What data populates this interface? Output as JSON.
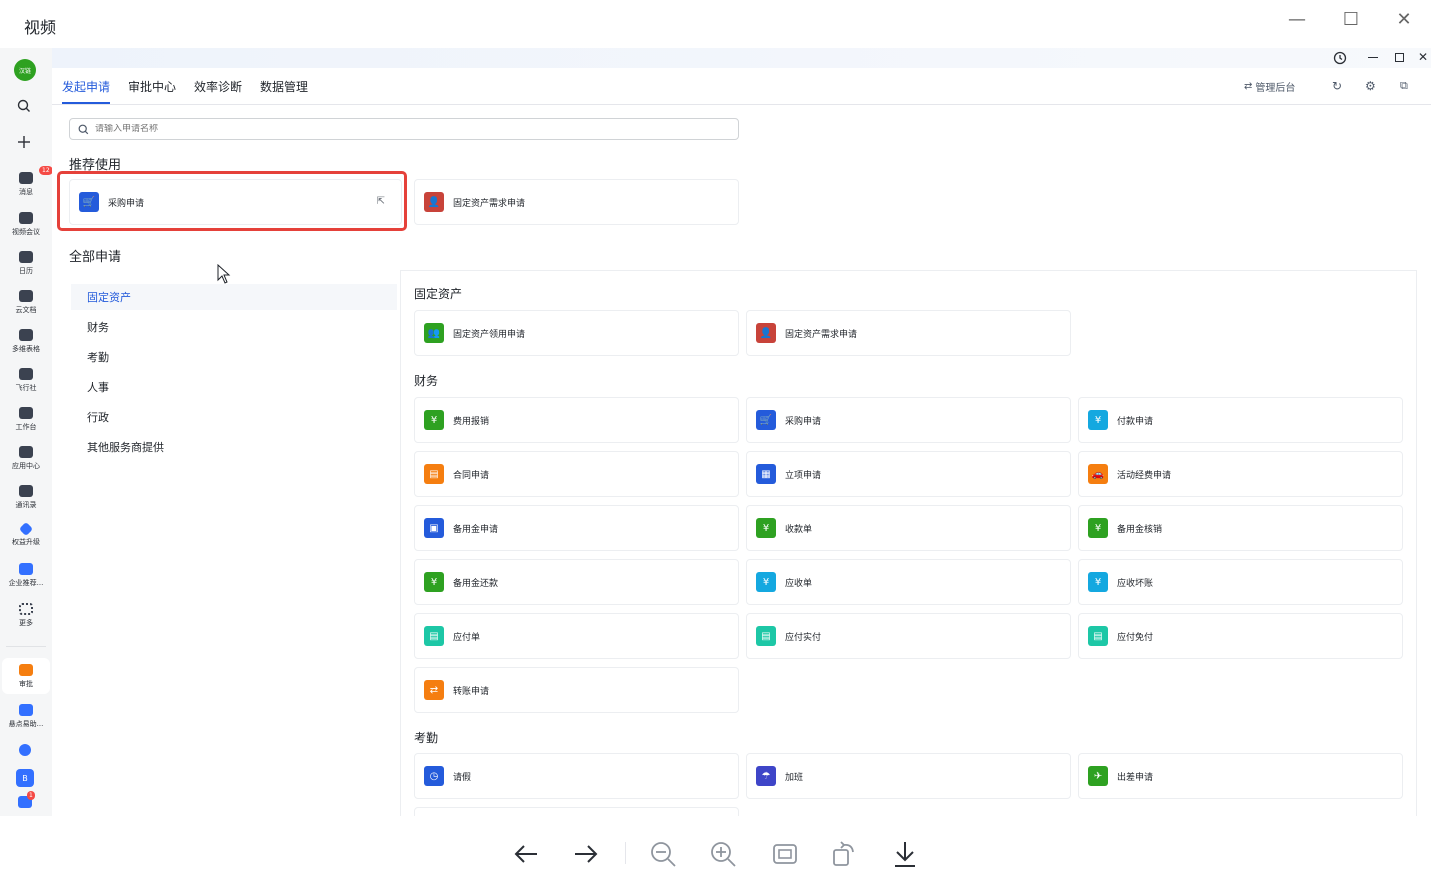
{
  "viewer": {
    "title": "视频",
    "minimize": "—",
    "maximize": "☐",
    "close": "✕"
  },
  "sidebar": {
    "avatar_text": "汉链",
    "items": [
      {
        "label": "消息",
        "badge": "12"
      },
      {
        "label": "视频会议"
      },
      {
        "label": "日历"
      },
      {
        "label": "云文档"
      },
      {
        "label": "多维表格"
      },
      {
        "label": "飞行社"
      },
      {
        "label": "工作台"
      },
      {
        "label": "应用中心"
      },
      {
        "label": "通讯录"
      },
      {
        "label": "权益升级"
      },
      {
        "label": "企业推荐..."
      },
      {
        "label": "更多"
      },
      {
        "label": "审批"
      },
      {
        "label": "悬点易助..."
      }
    ],
    "bottom_badge": "1",
    "bottom_letter": "B"
  },
  "header": {
    "tabs": [
      "发起申请",
      "审批中心",
      "效率诊断",
      "数据管理"
    ],
    "admin_label": "管理后台"
  },
  "search": {
    "placeholder": "请输入申请名称"
  },
  "recommended": {
    "title": "推荐使用",
    "items": [
      "采购申请",
      "固定资产需求申请"
    ]
  },
  "all": {
    "title": "全部申请",
    "categories": [
      "固定资产",
      "财务",
      "考勤",
      "人事",
      "行政",
      "其他服务商提供"
    ],
    "groups": [
      {
        "title": "固定资产",
        "items": [
          "固定资产领用申请",
          "固定资产需求申请"
        ]
      },
      {
        "title": "财务",
        "items": [
          "费用报销",
          "采购申请",
          "付款申请",
          "合同申请",
          "立项申请",
          "活动经费申请",
          "备用金申请",
          "收款单",
          "备用金核销",
          "备用金还款",
          "应收单",
          "应收坏账",
          "应付单",
          "应付实付",
          "应付免付",
          "转账申请"
        ]
      },
      {
        "title": "考勤",
        "items": [
          "请假",
          "加班",
          "出差申请"
        ]
      }
    ]
  },
  "colors": {
    "accent": "#245bdb",
    "highlight_border": "#e5413a",
    "icon_blue": "#245bdb",
    "icon_red": "#c8433a",
    "icon_green": "#2ea121",
    "icon_orange": "#f57e10",
    "icon_cyan": "#14a8e0",
    "icon_teal": "#1dc7a6",
    "icon_indigo": "#3e45c8"
  },
  "icons": {
    "cart": "cart-icon",
    "person": "person-plus-icon",
    "share": "share-icon"
  }
}
